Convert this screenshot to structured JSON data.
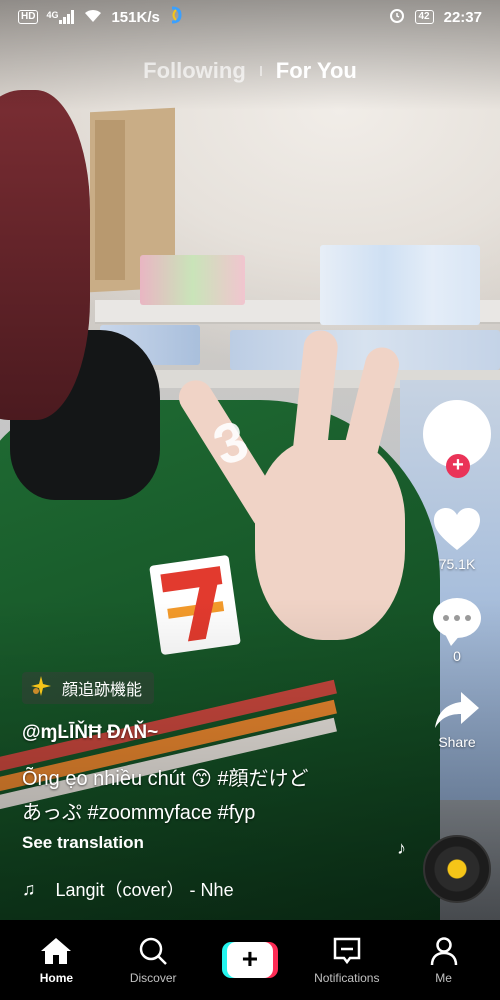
{
  "status_bar": {
    "hd": "HD",
    "network": "4G",
    "speed": "151K/s",
    "battery": "42",
    "time": "22:37"
  },
  "top_tabs": {
    "following": "Following",
    "for_you": "For You"
  },
  "overlay_text": "3",
  "actions": {
    "likes": "75.1K",
    "comments": "0",
    "share": "Share"
  },
  "effect": {
    "icon": "sparkle-icon",
    "label": "顔追跡機能"
  },
  "post": {
    "username": "@ɱĿĪŇĦ ĐΛŇ~",
    "caption_line1": "Õng ẹo nhiều chút 😙 #顔だけど",
    "caption_line2": "あっぷ #zoommyface #fyp",
    "see_translation": "See translation",
    "music": "Langit（cover） - Nhe"
  },
  "bottom_nav": [
    {
      "label": "Home",
      "icon": "home-icon",
      "active": true
    },
    {
      "label": "Discover",
      "icon": "search-icon",
      "active": false
    },
    {
      "label": "",
      "icon": "create-icon",
      "active": false
    },
    {
      "label": "Notifications",
      "icon": "inbox-icon",
      "active": false
    },
    {
      "label": "Me",
      "icon": "profile-icon",
      "active": false
    }
  ],
  "colors": {
    "accent_red": "#fe2c55",
    "accent_cyan": "#25f4ee",
    "follow_plus": "#ea3358"
  }
}
